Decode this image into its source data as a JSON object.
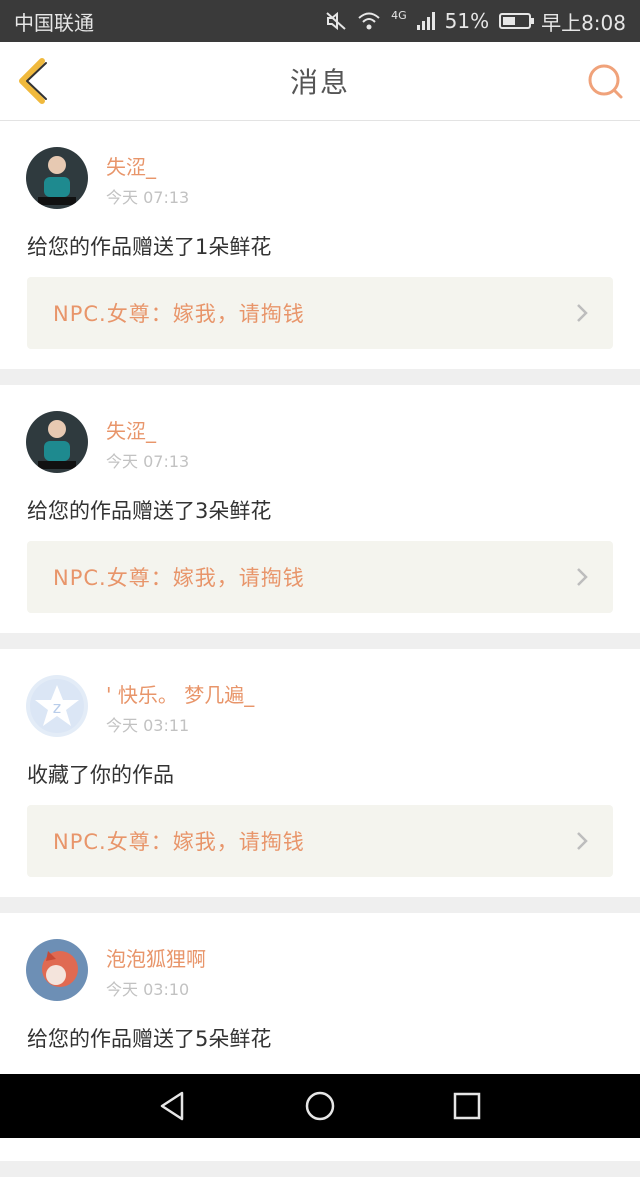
{
  "status_bar": {
    "carrier": "中国联通",
    "network": "4G",
    "battery": "51%",
    "battery_level": 0.51,
    "time": "早上8:08"
  },
  "header": {
    "title": "消息"
  },
  "colors": {
    "accent": "#e8956a",
    "header_icon": "#f0b93c",
    "search_icon": "#f0a27a"
  },
  "messages": [
    {
      "user": "失涩_",
      "time": "今天 07:13",
      "text": "给您的作品赠送了1朵鲜花",
      "work": "NPC.女尊：嫁我，请掏钱",
      "avatar": "photo-avatar"
    },
    {
      "user": "失涩_",
      "time": "今天 07:13",
      "text": "给您的作品赠送了3朵鲜花",
      "work": "NPC.女尊：嫁我，请掏钱",
      "avatar": "photo-avatar"
    },
    {
      "user": "' 快乐。 梦几遍_",
      "time": "今天 03:11",
      "text": "收藏了你的作品",
      "work": "NPC.女尊：嫁我，请掏钱",
      "avatar": "default-star-avatar"
    },
    {
      "user": "泡泡狐狸啊",
      "time": "今天 03:10",
      "text": "给您的作品赠送了5朵鲜花",
      "work": "",
      "avatar": "fox-avatar"
    }
  ]
}
